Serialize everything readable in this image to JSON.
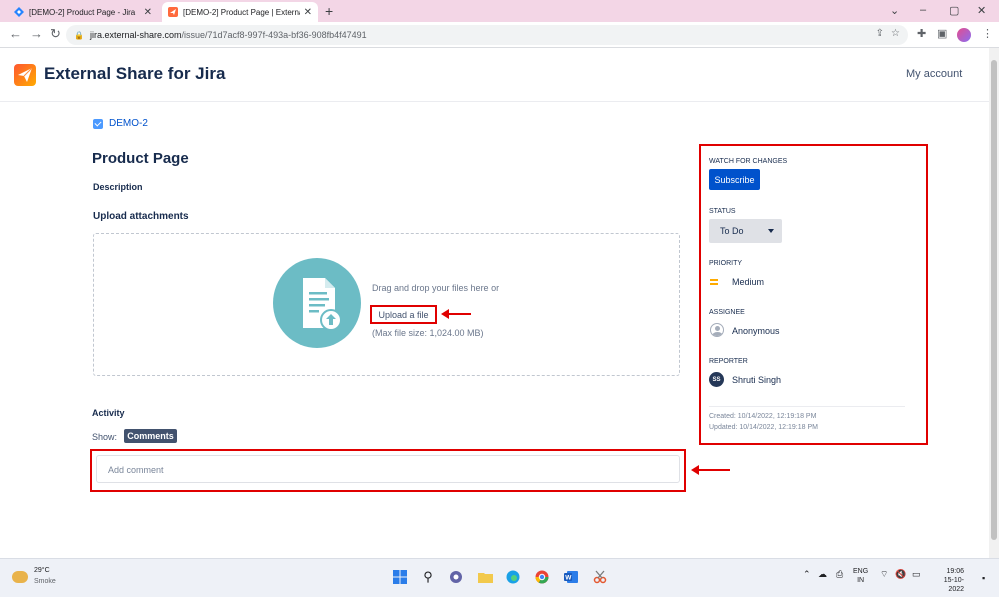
{
  "browser": {
    "tabs": [
      {
        "title": "[DEMO-2] Product Page - Jira",
        "active": false
      },
      {
        "title": "[DEMO-2] Product Page | Externa",
        "active": true
      }
    ],
    "url_host": "jira.external-share.com",
    "url_path": "/issue/71d7acf8-997f-493a-bf36-908fb4f47491",
    "window_controls": [
      "⌄",
      "–",
      "▢",
      "✕"
    ]
  },
  "app": {
    "brand": "External Share for Jira",
    "my_account": "My account"
  },
  "issue": {
    "key": "DEMO-2",
    "title": "Product Page",
    "description_label": "Description",
    "upload_label": "Upload attachments",
    "drag_text": "Drag and drop your files here or",
    "upload_button": "Upload a file",
    "max_size": "(Max file size: 1,024.00 MB)",
    "activity_label": "Activity",
    "show_label": "Show:",
    "comments_button": "Comments",
    "add_comment_placeholder": "Add comment"
  },
  "sidebar": {
    "watch_label": "WATCH FOR CHANGES",
    "subscribe_button": "Subscribe",
    "status_label": "STATUS",
    "status_value": "To Do",
    "priority_label": "PRIORITY",
    "priority_value": "Medium",
    "assignee_label": "ASSIGNEE",
    "assignee_value": "Anonymous",
    "reporter_label": "REPORTER",
    "reporter_initials": "SS",
    "reporter_value": "Shruti Singh",
    "created": "Created: 10/14/2022, 12:19:18 PM",
    "updated": "Updated: 10/14/2022, 12:19:18 PM"
  },
  "taskbar": {
    "temperature": "29°C",
    "weather": "Smoke",
    "lang_top": "ENG",
    "lang_bottom": "IN",
    "time": "19:06",
    "date": "15-10-2022"
  },
  "colors": {
    "annotation_red": "#e00000",
    "primary_blue": "#0052cc",
    "upload_circle": "#6cbcc5"
  }
}
